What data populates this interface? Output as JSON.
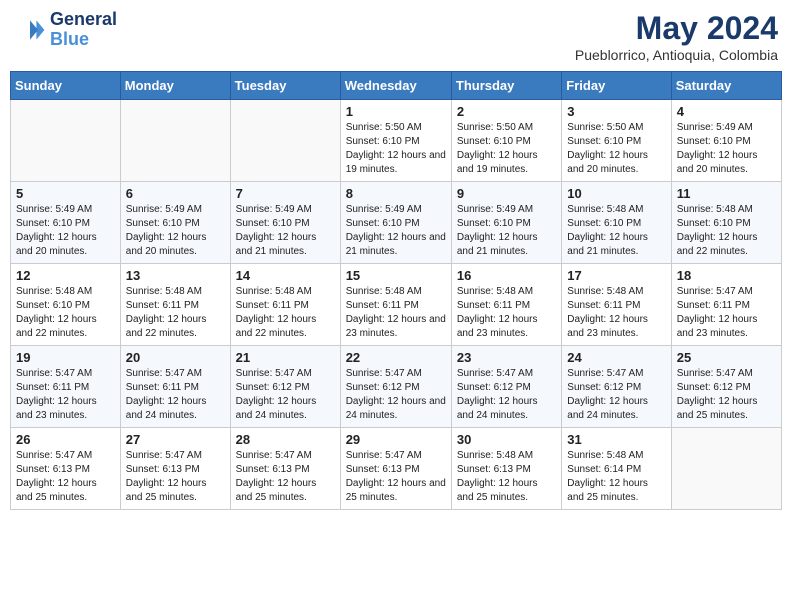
{
  "header": {
    "logo_line1": "General",
    "logo_line2": "Blue",
    "month_year": "May 2024",
    "location": "Pueblorrico, Antioquia, Colombia"
  },
  "days_of_week": [
    "Sunday",
    "Monday",
    "Tuesday",
    "Wednesday",
    "Thursday",
    "Friday",
    "Saturday"
  ],
  "weeks": [
    [
      {
        "day": "",
        "info": ""
      },
      {
        "day": "",
        "info": ""
      },
      {
        "day": "",
        "info": ""
      },
      {
        "day": "1",
        "info": "Sunrise: 5:50 AM\nSunset: 6:10 PM\nDaylight: 12 hours\nand 19 minutes."
      },
      {
        "day": "2",
        "info": "Sunrise: 5:50 AM\nSunset: 6:10 PM\nDaylight: 12 hours\nand 19 minutes."
      },
      {
        "day": "3",
        "info": "Sunrise: 5:50 AM\nSunset: 6:10 PM\nDaylight: 12 hours\nand 20 minutes."
      },
      {
        "day": "4",
        "info": "Sunrise: 5:49 AM\nSunset: 6:10 PM\nDaylight: 12 hours\nand 20 minutes."
      }
    ],
    [
      {
        "day": "5",
        "info": "Sunrise: 5:49 AM\nSunset: 6:10 PM\nDaylight: 12 hours\nand 20 minutes."
      },
      {
        "day": "6",
        "info": "Sunrise: 5:49 AM\nSunset: 6:10 PM\nDaylight: 12 hours\nand 20 minutes."
      },
      {
        "day": "7",
        "info": "Sunrise: 5:49 AM\nSunset: 6:10 PM\nDaylight: 12 hours\nand 21 minutes."
      },
      {
        "day": "8",
        "info": "Sunrise: 5:49 AM\nSunset: 6:10 PM\nDaylight: 12 hours\nand 21 minutes."
      },
      {
        "day": "9",
        "info": "Sunrise: 5:49 AM\nSunset: 6:10 PM\nDaylight: 12 hours\nand 21 minutes."
      },
      {
        "day": "10",
        "info": "Sunrise: 5:48 AM\nSunset: 6:10 PM\nDaylight: 12 hours\nand 21 minutes."
      },
      {
        "day": "11",
        "info": "Sunrise: 5:48 AM\nSunset: 6:10 PM\nDaylight: 12 hours\nand 22 minutes."
      }
    ],
    [
      {
        "day": "12",
        "info": "Sunrise: 5:48 AM\nSunset: 6:10 PM\nDaylight: 12 hours\nand 22 minutes."
      },
      {
        "day": "13",
        "info": "Sunrise: 5:48 AM\nSunset: 6:11 PM\nDaylight: 12 hours\nand 22 minutes."
      },
      {
        "day": "14",
        "info": "Sunrise: 5:48 AM\nSunset: 6:11 PM\nDaylight: 12 hours\nand 22 minutes."
      },
      {
        "day": "15",
        "info": "Sunrise: 5:48 AM\nSunset: 6:11 PM\nDaylight: 12 hours\nand 23 minutes."
      },
      {
        "day": "16",
        "info": "Sunrise: 5:48 AM\nSunset: 6:11 PM\nDaylight: 12 hours\nand 23 minutes."
      },
      {
        "day": "17",
        "info": "Sunrise: 5:48 AM\nSunset: 6:11 PM\nDaylight: 12 hours\nand 23 minutes."
      },
      {
        "day": "18",
        "info": "Sunrise: 5:47 AM\nSunset: 6:11 PM\nDaylight: 12 hours\nand 23 minutes."
      }
    ],
    [
      {
        "day": "19",
        "info": "Sunrise: 5:47 AM\nSunset: 6:11 PM\nDaylight: 12 hours\nand 23 minutes."
      },
      {
        "day": "20",
        "info": "Sunrise: 5:47 AM\nSunset: 6:11 PM\nDaylight: 12 hours\nand 24 minutes."
      },
      {
        "day": "21",
        "info": "Sunrise: 5:47 AM\nSunset: 6:12 PM\nDaylight: 12 hours\nand 24 minutes."
      },
      {
        "day": "22",
        "info": "Sunrise: 5:47 AM\nSunset: 6:12 PM\nDaylight: 12 hours\nand 24 minutes."
      },
      {
        "day": "23",
        "info": "Sunrise: 5:47 AM\nSunset: 6:12 PM\nDaylight: 12 hours\nand 24 minutes."
      },
      {
        "day": "24",
        "info": "Sunrise: 5:47 AM\nSunset: 6:12 PM\nDaylight: 12 hours\nand 24 minutes."
      },
      {
        "day": "25",
        "info": "Sunrise: 5:47 AM\nSunset: 6:12 PM\nDaylight: 12 hours\nand 25 minutes."
      }
    ],
    [
      {
        "day": "26",
        "info": "Sunrise: 5:47 AM\nSunset: 6:13 PM\nDaylight: 12 hours\nand 25 minutes."
      },
      {
        "day": "27",
        "info": "Sunrise: 5:47 AM\nSunset: 6:13 PM\nDaylight: 12 hours\nand 25 minutes."
      },
      {
        "day": "28",
        "info": "Sunrise: 5:47 AM\nSunset: 6:13 PM\nDaylight: 12 hours\nand 25 minutes."
      },
      {
        "day": "29",
        "info": "Sunrise: 5:47 AM\nSunset: 6:13 PM\nDaylight: 12 hours\nand 25 minutes."
      },
      {
        "day": "30",
        "info": "Sunrise: 5:48 AM\nSunset: 6:13 PM\nDaylight: 12 hours\nand 25 minutes."
      },
      {
        "day": "31",
        "info": "Sunrise: 5:48 AM\nSunset: 6:14 PM\nDaylight: 12 hours\nand 25 minutes."
      },
      {
        "day": "",
        "info": ""
      }
    ]
  ]
}
